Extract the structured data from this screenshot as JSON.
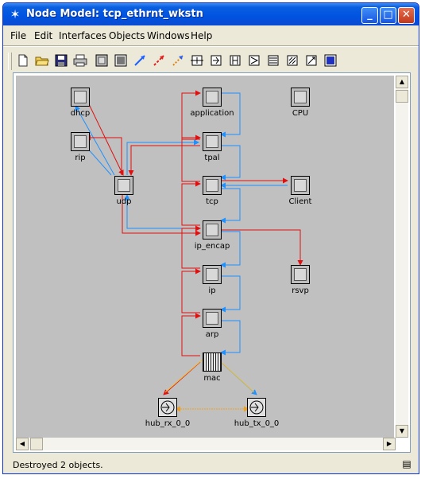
{
  "window": {
    "title": "Node Model: tcp_ethrnt_wkstn"
  },
  "menu": [
    "File",
    "Edit",
    "Interfaces",
    "Objects",
    "Windows",
    "Help"
  ],
  "toolbar_icons": [
    "new-icon",
    "open-icon",
    "save-icon",
    "print-icon",
    "fixed-node-icon",
    "queue-node-icon",
    "packet-stream-icon",
    "statistic-wire-icon",
    "logical-association-icon",
    "create-node-icon",
    "create-receiver-icon",
    "create-transmitter-icon",
    "create-bus-receiver-icon",
    "create-bus-transmitter-icon",
    "create-radio-icon",
    "create-antenna-icon",
    "create-queue-icon"
  ],
  "nodes": {
    "dhcp": "dhcp",
    "rip": "rip",
    "udp": "udp",
    "application": "application",
    "cpu": "CPU",
    "tpal": "tpal",
    "tcp": "tcp",
    "client": "Client",
    "ip_encap": "ip_encap",
    "ip": "ip",
    "rsvp": "rsvp",
    "arp": "arp",
    "mac": "mac",
    "hub_rx": "hub_rx_0_0",
    "hub_tx": "hub_tx_0_0"
  },
  "status": "Destroyed 2 objects.",
  "colors": {
    "stream_red": "#e01010",
    "stream_blue": "#1e90ff",
    "stat_wire": "#f0c030",
    "canvas": "#c0c0c0"
  }
}
